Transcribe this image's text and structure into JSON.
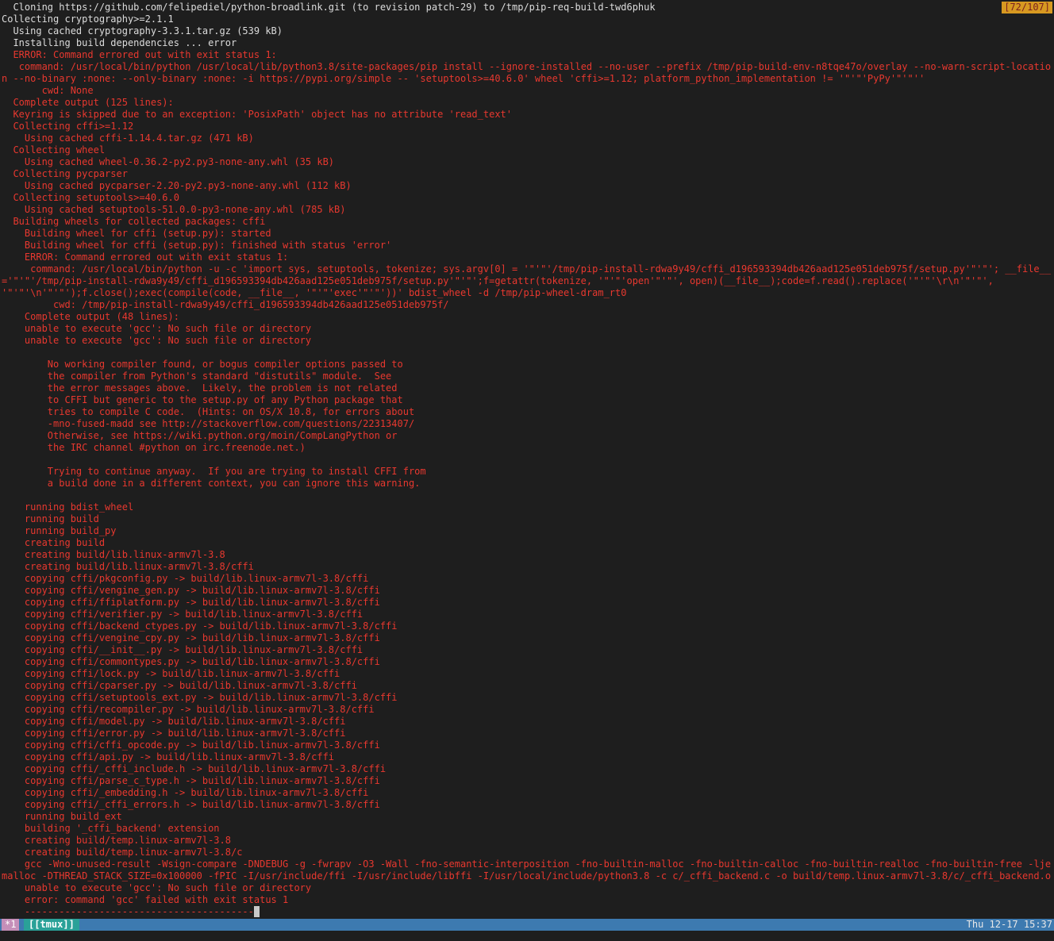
{
  "scroll_position": "[72/107]",
  "tmux": {
    "window_index": "*1",
    "session_name": "[[tmux]]",
    "clock": "Thu 12-17 15:37"
  },
  "colors": {
    "background": "#1e1e1e",
    "normal_text": "#dcdcdc",
    "error_text": "#e8382f",
    "statusbar": "#3d7ab0",
    "scroll_badge": "#d79921"
  },
  "lines": [
    {
      "c": "w",
      "t": "  Cloning https://github.com/felipediel/python-broadlink.git (to revision patch-29) to /tmp/pip-req-build-twd6phuk"
    },
    {
      "c": "w",
      "t": "Collecting cryptography>=2.1.1"
    },
    {
      "c": "w",
      "t": "  Using cached cryptography-3.3.1.tar.gz (539 kB)"
    },
    {
      "c": "w",
      "t": "  Installing build dependencies ... error"
    },
    {
      "c": "r",
      "t": "  ERROR: Command errored out with exit status 1:"
    },
    {
      "c": "r",
      "wrap": true,
      "t": "   command: /usr/local/bin/python /usr/local/lib/python3.8/site-packages/pip install --ignore-installed --no-user --prefix /tmp/pip-build-env-n8tqe47o/overlay --no-warn-script-location --no-binary :none: --only-binary :none: -i https://pypi.org/simple -- 'setuptools>=40.6.0' wheel 'cffi>=1.12; platform_python_implementation != '\"'\"'PyPy'\"'\"''"
    },
    {
      "c": "r",
      "t": "       cwd: None"
    },
    {
      "c": "r",
      "t": "  Complete output (125 lines):"
    },
    {
      "c": "r",
      "t": "  Keyring is skipped due to an exception: 'PosixPath' object has no attribute 'read_text'"
    },
    {
      "c": "r",
      "t": "  Collecting cffi>=1.12"
    },
    {
      "c": "r",
      "t": "    Using cached cffi-1.14.4.tar.gz (471 kB)"
    },
    {
      "c": "r",
      "t": "  Collecting wheel"
    },
    {
      "c": "r",
      "t": "    Using cached wheel-0.36.2-py2.py3-none-any.whl (35 kB)"
    },
    {
      "c": "r",
      "t": "  Collecting pycparser"
    },
    {
      "c": "r",
      "t": "    Using cached pycparser-2.20-py2.py3-none-any.whl (112 kB)"
    },
    {
      "c": "r",
      "t": "  Collecting setuptools>=40.6.0"
    },
    {
      "c": "r",
      "t": "    Using cached setuptools-51.0.0-py3-none-any.whl (785 kB)"
    },
    {
      "c": "r",
      "t": "  Building wheels for collected packages: cffi"
    },
    {
      "c": "r",
      "t": "    Building wheel for cffi (setup.py): started"
    },
    {
      "c": "r",
      "t": "    Building wheel for cffi (setup.py): finished with status 'error'"
    },
    {
      "c": "r",
      "t": "    ERROR: Command errored out with exit status 1:"
    },
    {
      "c": "r",
      "wrap": true,
      "t": "     command: /usr/local/bin/python -u -c 'import sys, setuptools, tokenize; sys.argv[0] = '\"'\"'/tmp/pip-install-rdwa9y49/cffi_d196593394db426aad125e051deb975f/setup.py'\"'\"'; __file__='\"'\"'/tmp/pip-install-rdwa9y49/cffi_d196593394db426aad125e051deb975f/setup.py'\"'\"';f=getattr(tokenize, '\"'\"'open'\"'\"', open)(__file__);code=f.read().replace('\"'\"'\\r\\n'\"'\"', '\"'\"'\\n'\"'\"');f.close();exec(compile(code, __file__, '\"'\"'exec'\"'\"'))' bdist_wheel -d /tmp/pip-wheel-dram_rt0"
    },
    {
      "c": "r",
      "t": "         cwd: /tmp/pip-install-rdwa9y49/cffi_d196593394db426aad125e051deb975f/"
    },
    {
      "c": "r",
      "t": "    Complete output (48 lines):"
    },
    {
      "c": "r",
      "t": "    unable to execute 'gcc': No such file or directory"
    },
    {
      "c": "r",
      "t": "    unable to execute 'gcc': No such file or directory"
    },
    {
      "c": "r",
      "t": ""
    },
    {
      "c": "r",
      "t": "        No working compiler found, or bogus compiler options passed to"
    },
    {
      "c": "r",
      "t": "        the compiler from Python's standard \"distutils\" module.  See"
    },
    {
      "c": "r",
      "t": "        the error messages above.  Likely, the problem is not related"
    },
    {
      "c": "r",
      "t": "        to CFFI but generic to the setup.py of any Python package that"
    },
    {
      "c": "r",
      "t": "        tries to compile C code.  (Hints: on OS/X 10.8, for errors about"
    },
    {
      "c": "r",
      "t": "        -mno-fused-madd see http://stackoverflow.com/questions/22313407/"
    },
    {
      "c": "r",
      "t": "        Otherwise, see https://wiki.python.org/moin/CompLangPython or"
    },
    {
      "c": "r",
      "t": "        the IRC channel #python on irc.freenode.net.)"
    },
    {
      "c": "r",
      "t": ""
    },
    {
      "c": "r",
      "t": "        Trying to continue anyway.  If you are trying to install CFFI from"
    },
    {
      "c": "r",
      "t": "        a build done in a different context, you can ignore this warning."
    },
    {
      "c": "r",
      "t": ""
    },
    {
      "c": "r",
      "t": "    running bdist_wheel"
    },
    {
      "c": "r",
      "t": "    running build"
    },
    {
      "c": "r",
      "t": "    running build_py"
    },
    {
      "c": "r",
      "t": "    creating build"
    },
    {
      "c": "r",
      "t": "    creating build/lib.linux-armv7l-3.8"
    },
    {
      "c": "r",
      "t": "    creating build/lib.linux-armv7l-3.8/cffi"
    },
    {
      "c": "r",
      "t": "    copying cffi/pkgconfig.py -> build/lib.linux-armv7l-3.8/cffi"
    },
    {
      "c": "r",
      "t": "    copying cffi/vengine_gen.py -> build/lib.linux-armv7l-3.8/cffi"
    },
    {
      "c": "r",
      "t": "    copying cffi/ffiplatform.py -> build/lib.linux-armv7l-3.8/cffi"
    },
    {
      "c": "r",
      "t": "    copying cffi/verifier.py -> build/lib.linux-armv7l-3.8/cffi"
    },
    {
      "c": "r",
      "t": "    copying cffi/backend_ctypes.py -> build/lib.linux-armv7l-3.8/cffi"
    },
    {
      "c": "r",
      "t": "    copying cffi/vengine_cpy.py -> build/lib.linux-armv7l-3.8/cffi"
    },
    {
      "c": "r",
      "t": "    copying cffi/__init__.py -> build/lib.linux-armv7l-3.8/cffi"
    },
    {
      "c": "r",
      "t": "    copying cffi/commontypes.py -> build/lib.linux-armv7l-3.8/cffi"
    },
    {
      "c": "r",
      "t": "    copying cffi/lock.py -> build/lib.linux-armv7l-3.8/cffi"
    },
    {
      "c": "r",
      "t": "    copying cffi/cparser.py -> build/lib.linux-armv7l-3.8/cffi"
    },
    {
      "c": "r",
      "t": "    copying cffi/setuptools_ext.py -> build/lib.linux-armv7l-3.8/cffi"
    },
    {
      "c": "r",
      "t": "    copying cffi/recompiler.py -> build/lib.linux-armv7l-3.8/cffi"
    },
    {
      "c": "r",
      "t": "    copying cffi/model.py -> build/lib.linux-armv7l-3.8/cffi"
    },
    {
      "c": "r",
      "t": "    copying cffi/error.py -> build/lib.linux-armv7l-3.8/cffi"
    },
    {
      "c": "r",
      "t": "    copying cffi/cffi_opcode.py -> build/lib.linux-armv7l-3.8/cffi"
    },
    {
      "c": "r",
      "t": "    copying cffi/api.py -> build/lib.linux-armv7l-3.8/cffi"
    },
    {
      "c": "r",
      "t": "    copying cffi/_cffi_include.h -> build/lib.linux-armv7l-3.8/cffi"
    },
    {
      "c": "r",
      "t": "    copying cffi/parse_c_type.h -> build/lib.linux-armv7l-3.8/cffi"
    },
    {
      "c": "r",
      "t": "    copying cffi/_embedding.h -> build/lib.linux-armv7l-3.8/cffi"
    },
    {
      "c": "r",
      "t": "    copying cffi/_cffi_errors.h -> build/lib.linux-armv7l-3.8/cffi"
    },
    {
      "c": "r",
      "t": "    running build_ext"
    },
    {
      "c": "r",
      "t": "    building '_cffi_backend' extension"
    },
    {
      "c": "r",
      "t": "    creating build/temp.linux-armv7l-3.8"
    },
    {
      "c": "r",
      "t": "    creating build/temp.linux-armv7l-3.8/c"
    },
    {
      "c": "r",
      "wrap": true,
      "t": "    gcc -Wno-unused-result -Wsign-compare -DNDEBUG -g -fwrapv -O3 -Wall -fno-semantic-interposition -fno-builtin-malloc -fno-builtin-calloc -fno-builtin-realloc -fno-builtin-free -ljemalloc -DTHREAD_STACK_SIZE=0x100000 -fPIC -I/usr/include/ffi -I/usr/include/libffi -I/usr/local/include/python3.8 -c c/_cffi_backend.c -o build/temp.linux-armv7l-3.8/c/_cffi_backend.o"
    },
    {
      "c": "r",
      "t": "    unable to execute 'gcc': No such file or directory"
    },
    {
      "c": "r",
      "t": "    error: command 'gcc' failed with exit status 1"
    },
    {
      "c": "r",
      "t": "    ----------------------------------------",
      "cursor": true
    }
  ]
}
